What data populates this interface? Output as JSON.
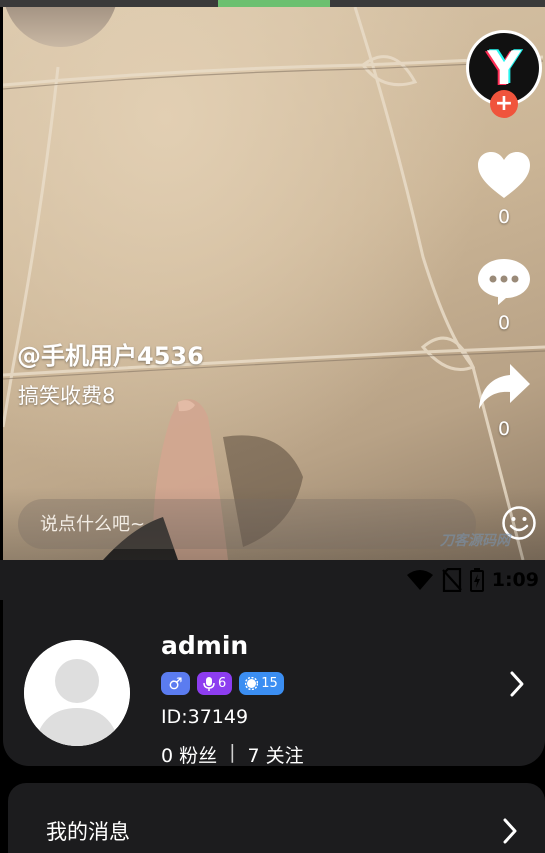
{
  "video": {
    "author": "@手机用户4536",
    "caption": "搞笑收费8",
    "like_count": "0",
    "comment_count": "0",
    "share_count": "0",
    "comment_placeholder": "说点什么吧~",
    "watermark": "刀客源码网"
  },
  "status_bar": {
    "time": "1:09",
    "icons": [
      "wifi-icon",
      "no-sim-icon",
      "battery-icon"
    ]
  },
  "profile": {
    "name": "admin",
    "gender_symbol": "♂",
    "voice_level": "6",
    "level": "15",
    "id_text": "ID:37149",
    "fans_text": "0 粉丝",
    "separator": "|",
    "follow_text": "7 关注"
  },
  "menu": {
    "messages_label": "我的消息"
  },
  "colors": {
    "card_bg": "#1c1c1e",
    "follow_plus": "#f0543c",
    "gender_badge": "#5b7cf0",
    "voice_badge": "#8d3df0",
    "level_badge": "#3b8ef2",
    "progress_segment": "#6cc070"
  }
}
